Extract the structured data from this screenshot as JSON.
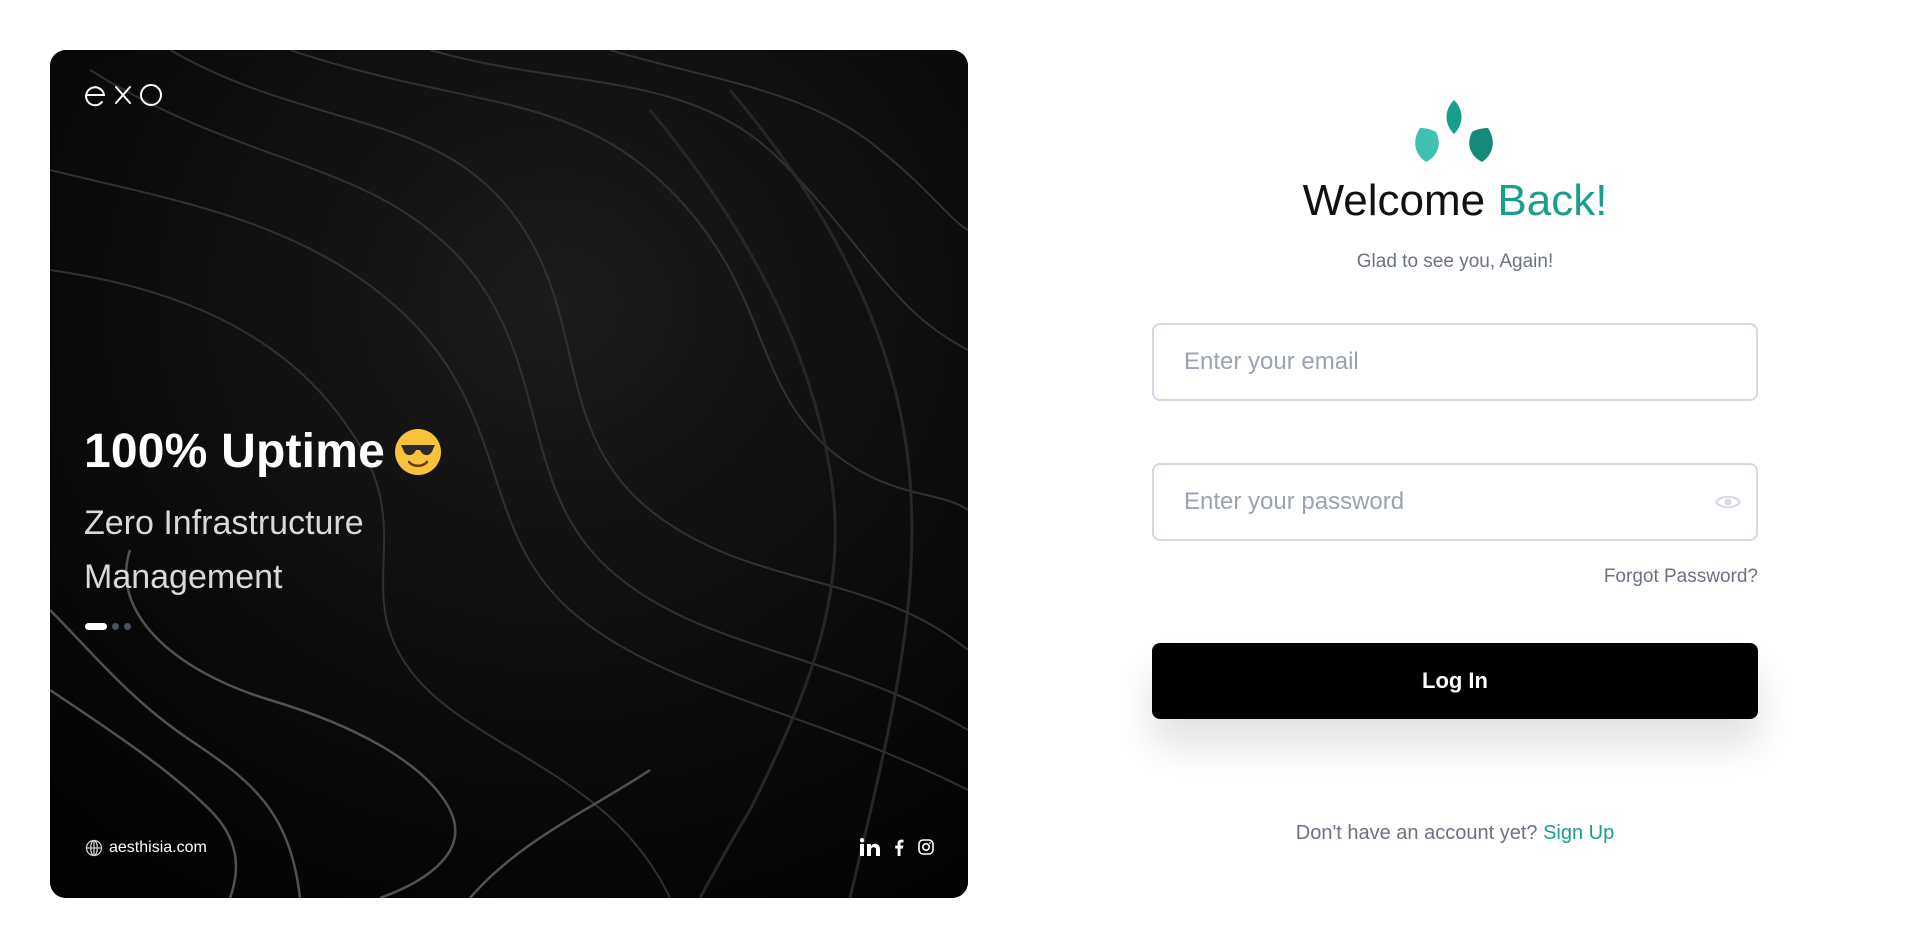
{
  "hero": {
    "brand": "exo",
    "title": "100% Uptime",
    "title_emoji": "smiling-face-with-sunglasses",
    "subtitle": "Zero Infrastructure Management",
    "slides": {
      "total": 3,
      "active": 1
    },
    "website": "aesthisia.com",
    "social_icons": [
      "linkedin-icon",
      "facebook-icon",
      "instagram-icon"
    ]
  },
  "login": {
    "welcome_prefix": "Welcome",
    "welcome_accent": "Back!",
    "tagline": "Glad to see you, Again!",
    "email_placeholder": "Enter your email",
    "password_placeholder": "Enter your password",
    "forgot_password": "Forgot Password?",
    "submit_label": "Log In",
    "signup_prompt": "Don't have an account yet?",
    "signup_link": "Sign Up"
  },
  "colors": {
    "accent": "#1a9e8c",
    "button": "#000000",
    "hero_background": "#050505"
  }
}
